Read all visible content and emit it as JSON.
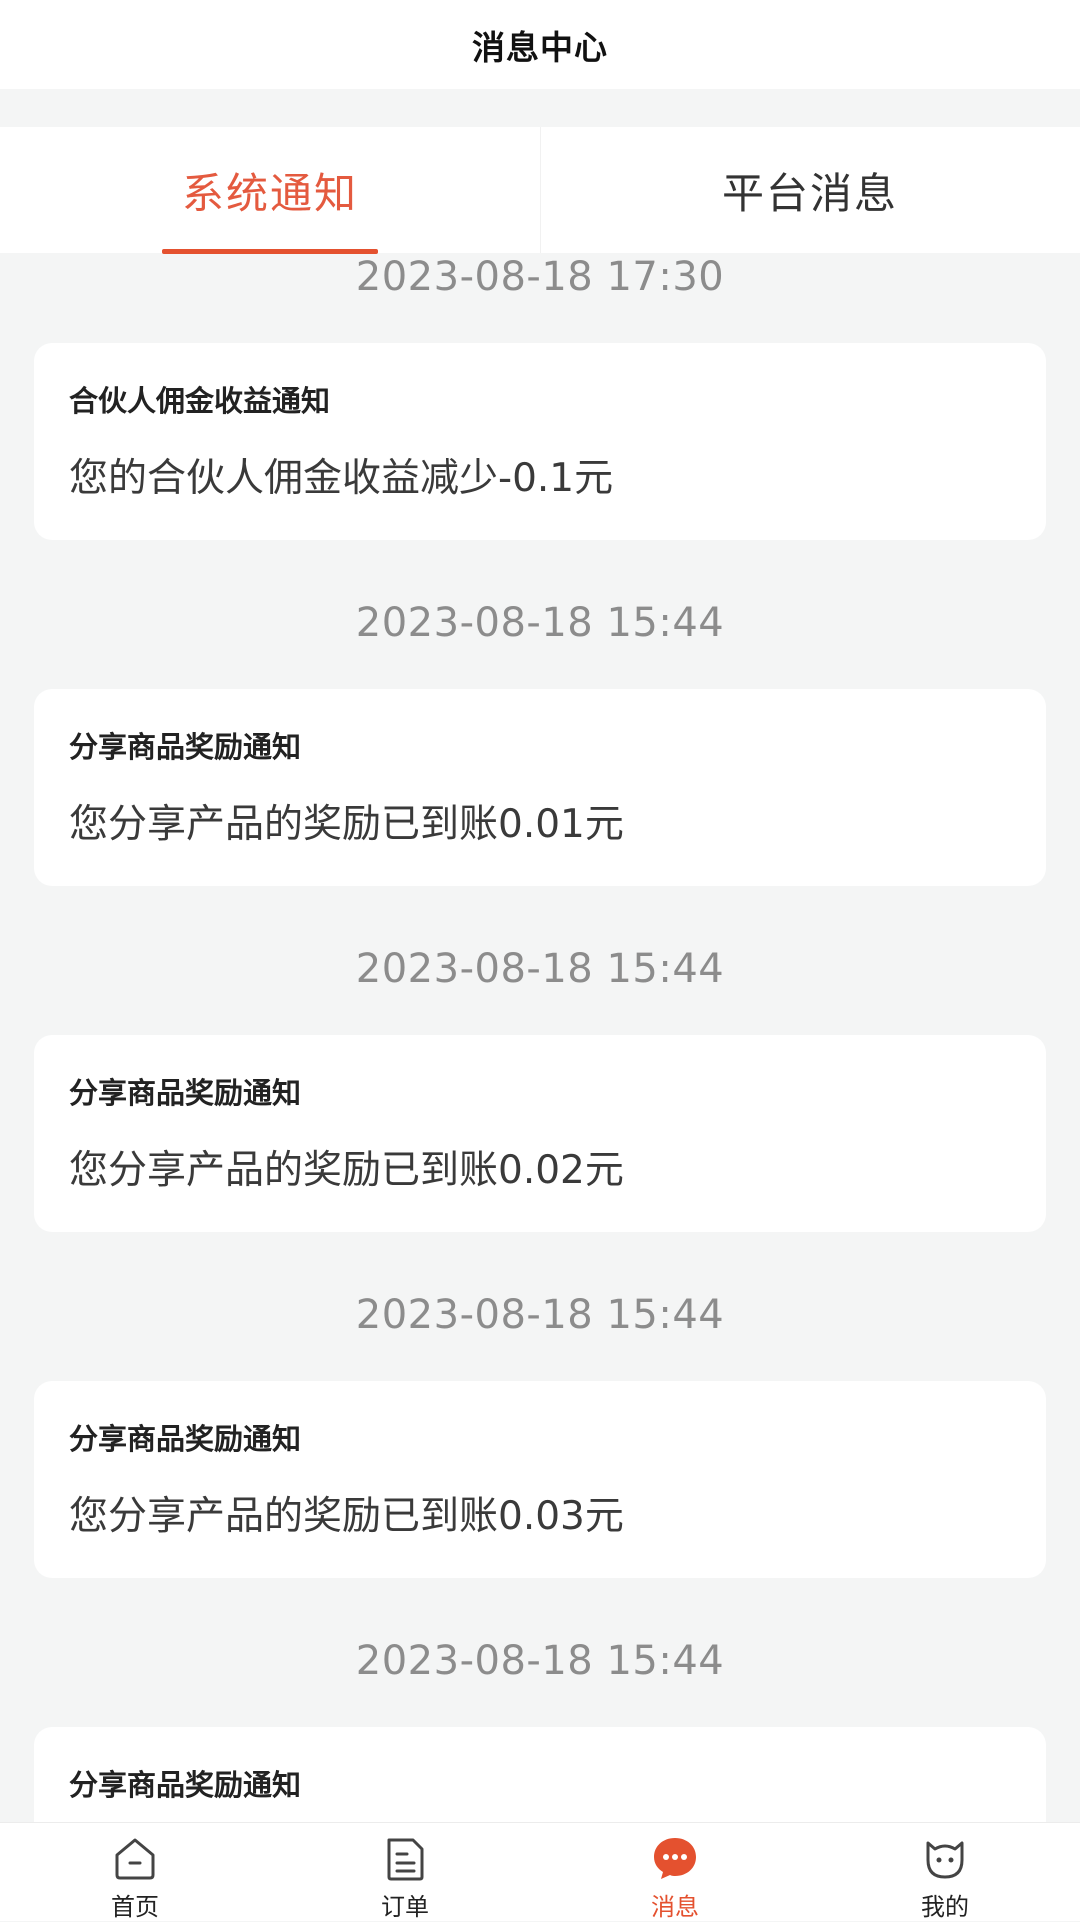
{
  "header": {
    "title": "消息中心"
  },
  "tabs": [
    {
      "label": "系统通知",
      "active": true
    },
    {
      "label": "平台消息",
      "active": false
    }
  ],
  "messages": [
    {
      "time": "2023-08-18 17:30",
      "title": "合伙人佣金收益通知",
      "body": "您的合伙人佣金收益减少-0.1元"
    },
    {
      "time": "2023-08-18 15:44",
      "title": "分享商品奖励通知",
      "body": "您分享产品的奖励已到账0.01元"
    },
    {
      "time": "2023-08-18 15:44",
      "title": "分享商品奖励通知",
      "body": "您分享产品的奖励已到账0.02元"
    },
    {
      "time": "2023-08-18 15:44",
      "title": "分享商品奖励通知",
      "body": "您分享产品的奖励已到账0.03元"
    },
    {
      "time": "2023-08-18 15:44",
      "title": "分享商品奖励通知",
      "body": ""
    }
  ],
  "tabbar": [
    {
      "label": "首页",
      "icon": "home-icon",
      "active": false
    },
    {
      "label": "订单",
      "icon": "order-icon",
      "active": false
    },
    {
      "label": "消息",
      "icon": "message-icon",
      "active": true
    },
    {
      "label": "我的",
      "icon": "profile-icon",
      "active": false
    }
  ],
  "colors": {
    "accent": "#e4512f",
    "background": "#f4f5f5"
  }
}
